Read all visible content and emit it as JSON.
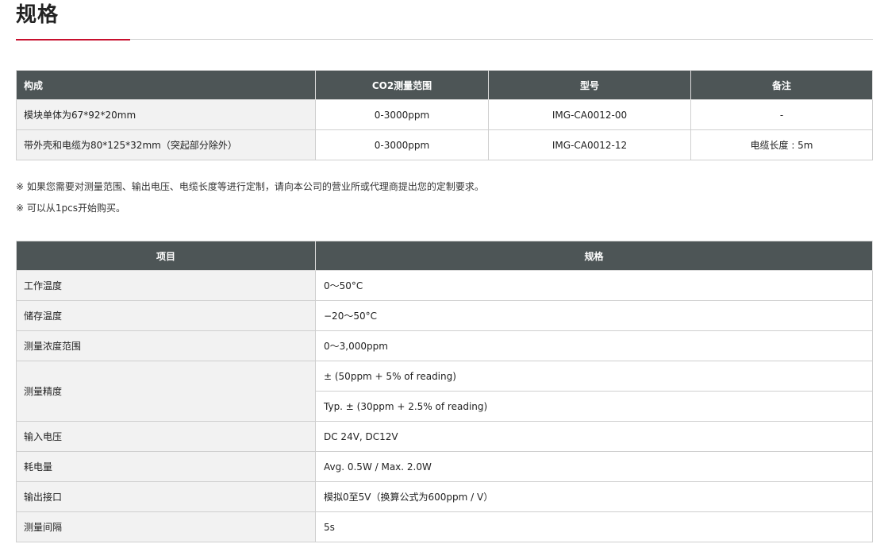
{
  "page": {
    "title": "规格"
  },
  "table1": {
    "headers": [
      "构成",
      "CO2测量范围",
      "型号",
      "备注"
    ],
    "rows": [
      [
        "模块单体为67*92*20mm",
        "0-3000ppm",
        "IMG-CA0012-00",
        "-"
      ],
      [
        "带外壳和电缆为80*125*32mm（突起部分除外）",
        "0-3000ppm",
        "IMG-CA0012-12",
        "电缆长度 : 5m"
      ]
    ]
  },
  "notes": [
    "※ 如果您需要对测量范围、输出电压、电缆长度等进行定制，请向本公司的营业所或代理商提出您的定制要求。",
    "※ 可以从1pcs开始购买。"
  ],
  "table2": {
    "headers": [
      "项目",
      "规格"
    ],
    "rows": {
      "r0": {
        "label": "工作温度",
        "value": "0～50°C"
      },
      "r1": {
        "label": "储存温度",
        "value": "−20～50°C"
      },
      "r2": {
        "label": "测量浓度范围",
        "value": "0～3,000ppm"
      },
      "r3": {
        "label": "测量精度",
        "value1": "± (50ppm + 5% of reading)",
        "value2": "Typ. ± (30ppm + 2.5% of reading)"
      },
      "r4": {
        "label": "输入电压",
        "value": "DC 24V, DC12V"
      },
      "r5": {
        "label": "耗电量",
        "value": "Avg. 0.5W / Max. 2.0W"
      },
      "r6": {
        "label": "输出接口",
        "value": "模拟0至5V（换算公式为600ppm / V）"
      },
      "r7": {
        "label": "测量间隔",
        "value": "5s"
      }
    }
  }
}
